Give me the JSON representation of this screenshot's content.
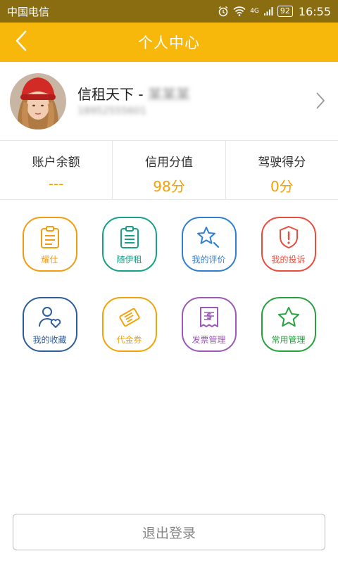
{
  "status_bar": {
    "carrier": "中国电信",
    "network": "4G",
    "battery": "92",
    "time": "16:55"
  },
  "nav": {
    "title": "个人中心"
  },
  "profile": {
    "name": "信租天下 -",
    "name_blurred": "某某某",
    "phone_blurred": "18952555601"
  },
  "stats": [
    {
      "label": "账户余额",
      "value": "---"
    },
    {
      "label": "信用分值",
      "value": "98分"
    },
    {
      "label": "驾驶得分",
      "value": "0分"
    }
  ],
  "menu": [
    {
      "label": "耀仕",
      "icon": "clipboard-icon",
      "color": "#f39c12"
    },
    {
      "label": "随伊租",
      "icon": "clipboard-list-icon",
      "color": "#16a085"
    },
    {
      "label": "我的评价",
      "icon": "star-comment-icon",
      "color": "#2f7fd1"
    },
    {
      "label": "我的投诉",
      "icon": "shield-alert-icon",
      "color": "#e74c3c"
    },
    {
      "label": "我的收藏",
      "icon": "user-heart-icon",
      "color": "#2e5d9a"
    },
    {
      "label": "代金券",
      "icon": "ticket-icon",
      "color": "#f0a30a"
    },
    {
      "label": "发票管理",
      "icon": "receipt-icon",
      "color": "#9b59b6"
    },
    {
      "label": "常用管理",
      "icon": "star-icon",
      "color": "#27a040"
    }
  ],
  "logout_label": "退出登录"
}
